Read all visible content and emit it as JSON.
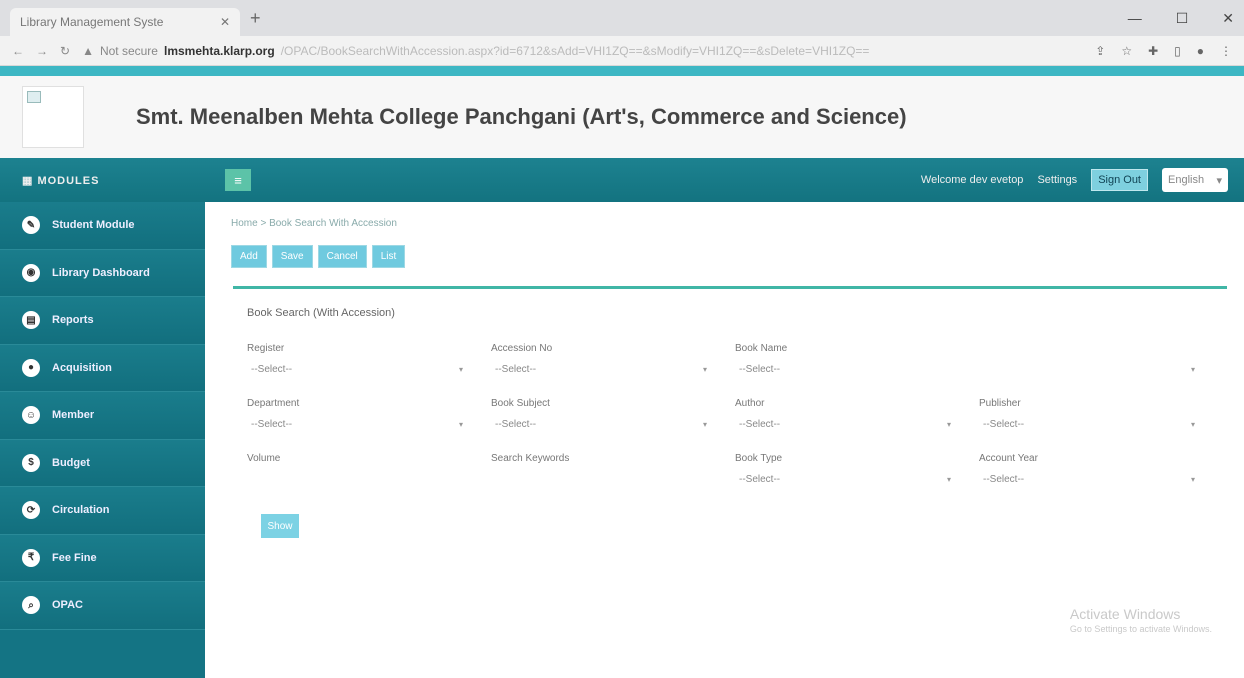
{
  "browser": {
    "tab_title": "Library Management Syste",
    "url_warning": "Not secure",
    "url_host": "lmsmehta.klarp.org",
    "url_path": "/OPAC/BookSearchWithAccession.aspx?id=6712&sAdd=VHI1ZQ==&sModify=VHI1ZQ==&sDelete=VHI1ZQ=="
  },
  "header": {
    "college_name": "Smt. Meenalben Mehta College Panchgani (Art's, Commerce and Science)"
  },
  "topnav": {
    "modules_label": "MODULES",
    "welcome": "Welcome dev evetop",
    "settings": "Settings",
    "sign_out": "Sign Out",
    "language": "English"
  },
  "sidebar": {
    "items": [
      {
        "label": "Student Module",
        "icon": "student-icon"
      },
      {
        "label": "Library Dashboard",
        "icon": "dashboard-icon"
      },
      {
        "label": "Reports",
        "icon": "reports-icon"
      },
      {
        "label": "Acquisition",
        "icon": "acquisition-icon"
      },
      {
        "label": "Member",
        "icon": "member-icon"
      },
      {
        "label": "Budget",
        "icon": "budget-icon"
      },
      {
        "label": "Circulation",
        "icon": "circulation-icon"
      },
      {
        "label": "Fee Fine",
        "icon": "fee-fine-icon"
      },
      {
        "label": "OPAC",
        "icon": "opac-icon"
      }
    ]
  },
  "main": {
    "breadcrumb": "Home > Book Search With Accession",
    "actions": {
      "add": "Add",
      "save": "Save",
      "cancel": "Cancel",
      "list": "List"
    },
    "panel_title": "Book Search (With Accession)",
    "fields": {
      "register": {
        "label": "Register",
        "value": "--Select--"
      },
      "accession_no": {
        "label": "Accession No",
        "value": "--Select--"
      },
      "book_name": {
        "label": "Book Name",
        "value": "--Select--"
      },
      "department": {
        "label": "Department",
        "value": "--Select--"
      },
      "book_subject": {
        "label": "Book Subject",
        "value": "--Select--"
      },
      "author": {
        "label": "Author",
        "value": "--Select--"
      },
      "publisher": {
        "label": "Publisher",
        "value": "--Select--"
      },
      "volume": {
        "label": "Volume",
        "value": ""
      },
      "search_keywords": {
        "label": "Search Keywords",
        "value": ""
      },
      "book_type": {
        "label": "Book Type",
        "value": "--Select--"
      },
      "account_year": {
        "label": "Account Year",
        "value": "--Select--"
      }
    },
    "show_button": "Show"
  },
  "watermark": {
    "title": "Activate Windows",
    "subtitle": "Go to Settings to activate Windows."
  },
  "colors": {
    "accent": "#3db7c4",
    "nav": "#137380",
    "button": "#6fcadf"
  }
}
